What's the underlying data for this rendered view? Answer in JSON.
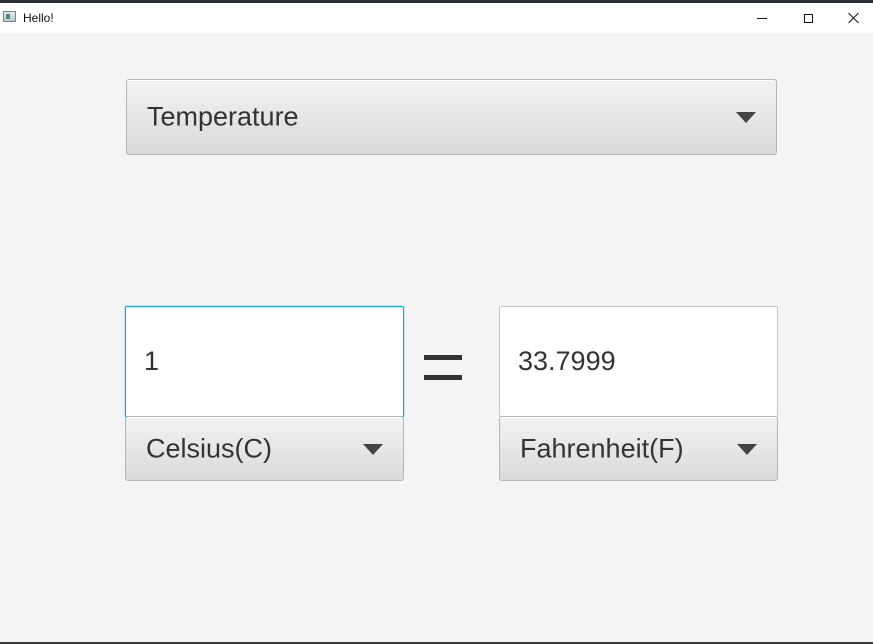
{
  "window": {
    "title": "Hello!"
  },
  "converter": {
    "category": "Temperature",
    "from": {
      "value": "1",
      "unit": "Celsius(C)"
    },
    "to": {
      "value": "33.7999",
      "unit": "Fahrenheit(F)"
    }
  },
  "icons": {
    "app": "app-window-icon",
    "dropdown": "chevron-down-icon",
    "equals": "equals-icon"
  },
  "colors": {
    "focus_border": "#1aa3d4",
    "text": "#333333",
    "background": "#f4f4f4"
  }
}
